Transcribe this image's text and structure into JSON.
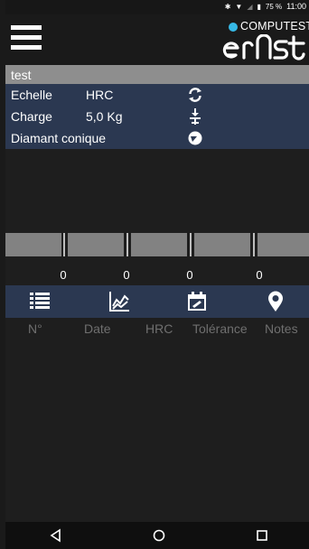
{
  "status": {
    "battery": "75 %",
    "time": "11:00"
  },
  "brand": {
    "name": "COMPUTEST",
    "logo_text": "ernst"
  },
  "title": "test",
  "params": [
    {
      "label": "Echelle",
      "value": "HRC",
      "icon": "refresh-icon"
    },
    {
      "label": "Charge",
      "value": "5,0 Kg",
      "icon": "load-icon"
    },
    {
      "label": "Diamant conique",
      "value": "",
      "icon": "indenter-icon"
    }
  ],
  "readings": [
    "0",
    "0",
    "0",
    "0"
  ],
  "tabs": [
    {
      "icon": "list-icon"
    },
    {
      "icon": "chart-icon"
    },
    {
      "icon": "calendar-icon"
    },
    {
      "icon": "location-pin-icon"
    }
  ],
  "columns": [
    "N°",
    "Date",
    "HRC",
    "Tolérance",
    "Notes"
  ],
  "colors": {
    "accent": "#36b9e6",
    "panel": "#2b3851",
    "title_bar": "#8e8e8e"
  }
}
